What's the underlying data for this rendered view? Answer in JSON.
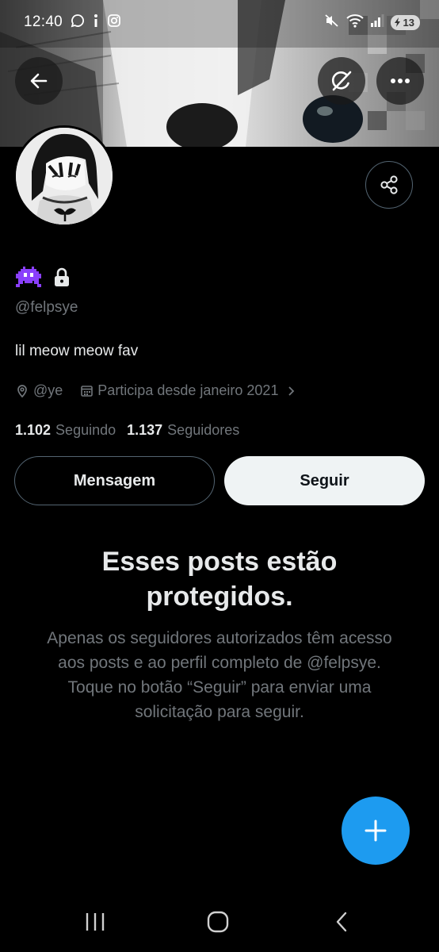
{
  "status_bar": {
    "time": "12:40",
    "battery_level": "13"
  },
  "header": {
    "back_icon": "arrow-left-icon",
    "grok_icon": "grok-icon",
    "more_icon": "more-horizontal-icon"
  },
  "profile": {
    "handle": "@felpsye",
    "bio": "lil meow meow fav",
    "location": "@ye",
    "joined": "Participa desde janeiro 2021",
    "following_count": "1.102",
    "following_label": "Seguindo",
    "followers_count": "1.137",
    "followers_label": "Seguidores",
    "message_label": "Mensagem",
    "follow_label": "Seguir"
  },
  "protected": {
    "title": "Esses posts estão protegidos.",
    "description": "Apenas os seguidores autorizados têm acesso aos posts e ao perfil completo de @felpsye. Toque no botão “Seguir” para enviar uma solicitação para seguir."
  },
  "colors": {
    "background": "#000000",
    "accent": "#1d9bf0",
    "secondary_text": "#71767b",
    "primary_text": "#e7e9ea",
    "border": "#536471",
    "emoji_purple": "#8a3ffc"
  }
}
